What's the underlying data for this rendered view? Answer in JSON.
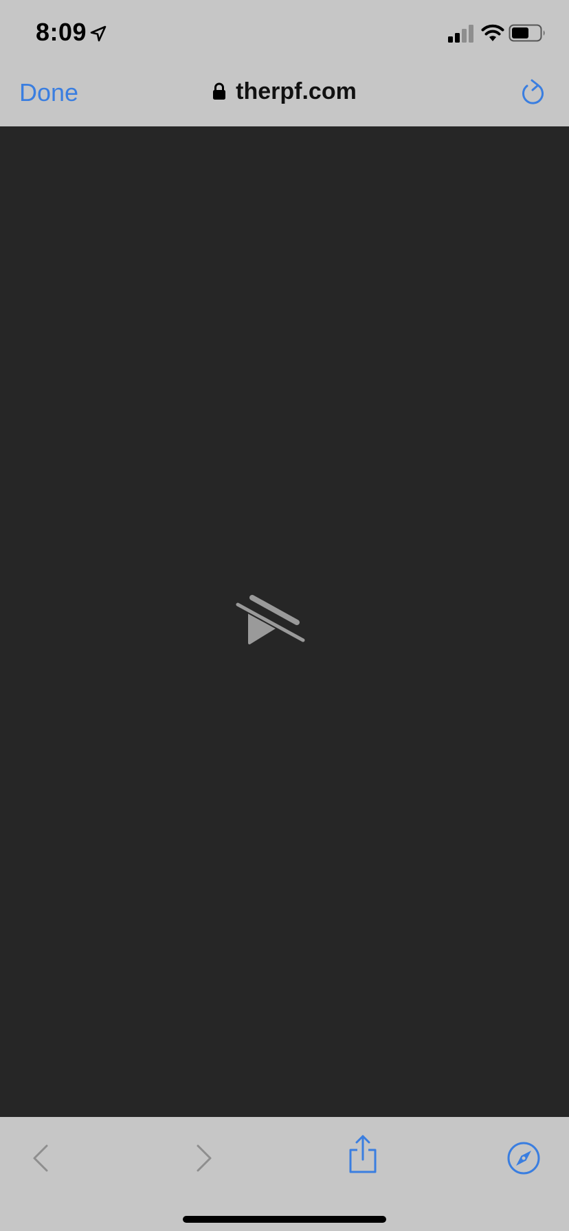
{
  "status_bar": {
    "time": "8:09",
    "icons": [
      "location-arrow-icon",
      "cellular-signal-icon",
      "wifi-icon",
      "battery-icon"
    ]
  },
  "nav_bar": {
    "done_label": "Done",
    "address": "therpf.com",
    "lock_icon": "lock-icon",
    "reload_icon": "reload-icon"
  },
  "content": {
    "video_state_icon": "video-unavailable-icon",
    "background_color": "#262626"
  },
  "toolbar": {
    "icons": [
      "back-icon",
      "forward-icon",
      "share-icon",
      "safari-compass-icon"
    ]
  },
  "colors": {
    "accent": "#3a7ee0",
    "bar_background": "#c6c6c6",
    "disabled": "#8e8e8e",
    "icon_gray": "#9a9a9a"
  }
}
